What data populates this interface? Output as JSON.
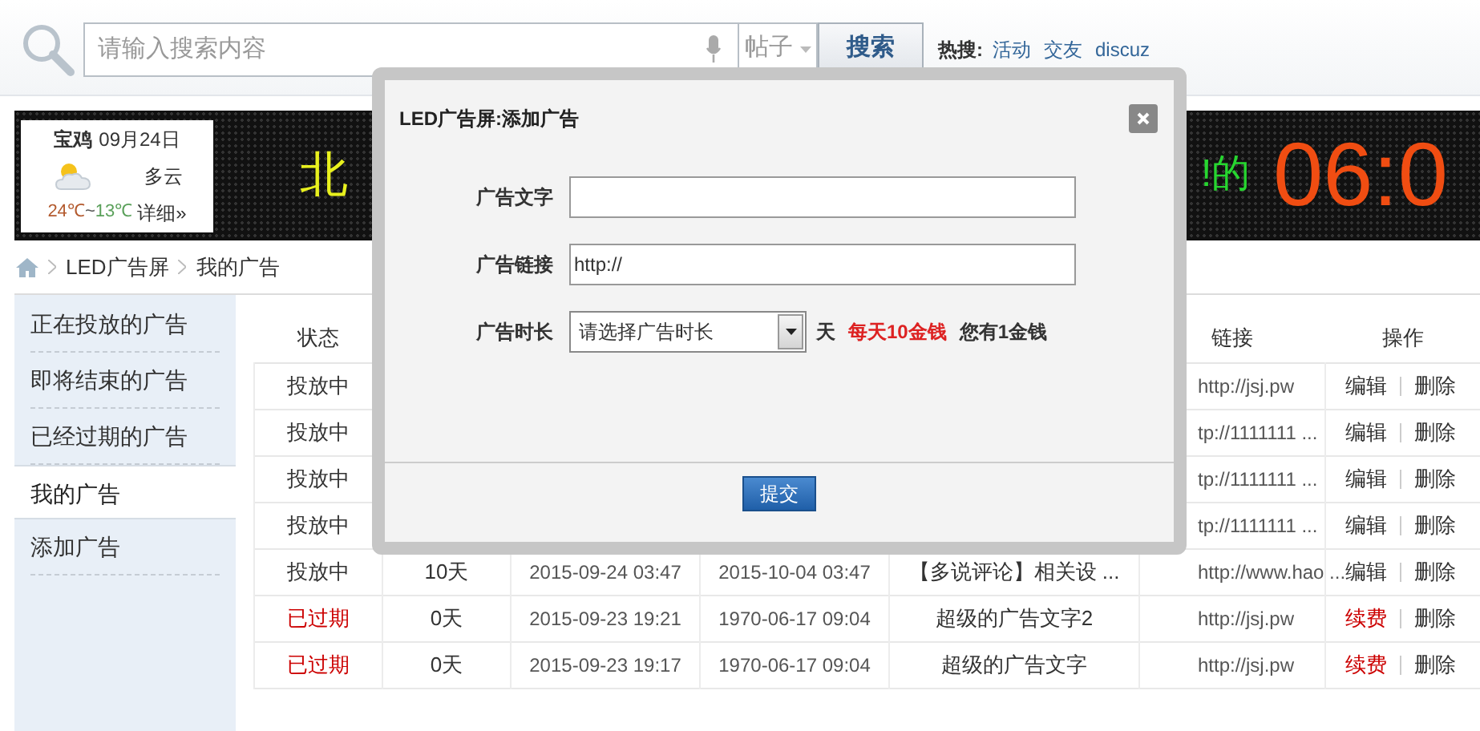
{
  "search": {
    "placeholder": "请输入搜索内容",
    "scope": "帖子",
    "button": "搜索",
    "hot_label": "热搜:",
    "hot_links": [
      "活动",
      "交友",
      "discuz"
    ]
  },
  "led_banner": {
    "weather": {
      "city": "宝鸡",
      "date": "09月24日",
      "condition": "多云",
      "high": "24℃",
      "separator": "~",
      "low": "13℃",
      "details": "详细»"
    },
    "text_left": "北",
    "text_right": "!的",
    "clock": "06:0"
  },
  "breadcrumb": [
    "LED广告屏",
    "我的广告"
  ],
  "sidebar": {
    "items": [
      {
        "label": "正在投放的广告",
        "selected": false
      },
      {
        "label": "即将结束的广告",
        "selected": false
      },
      {
        "label": "已经过期的广告",
        "selected": false
      },
      {
        "label": "我的广告",
        "selected": true
      },
      {
        "label": "添加广告",
        "selected": false
      }
    ]
  },
  "table": {
    "columns": [
      "状态",
      null,
      null,
      null,
      null,
      "链接",
      "操作"
    ],
    "rows": [
      {
        "status": "投放中",
        "expired": false,
        "link": "http://jsj.pw",
        "actions": [
          {
            "label": "编辑",
            "kind": "edit"
          },
          {
            "label": "删除",
            "kind": "delete"
          }
        ]
      },
      {
        "status": "投放中",
        "expired": false,
        "link": "tp://1111111 ...",
        "actions": [
          {
            "label": "编辑",
            "kind": "edit"
          },
          {
            "label": "删除",
            "kind": "delete"
          }
        ]
      },
      {
        "status": "投放中",
        "expired": false,
        "link": "tp://1111111 ...",
        "actions": [
          {
            "label": "编辑",
            "kind": "edit"
          },
          {
            "label": "删除",
            "kind": "delete"
          }
        ]
      },
      {
        "status": "投放中",
        "expired": false,
        "link": "tp://1111111 ...",
        "actions": [
          {
            "label": "编辑",
            "kind": "edit"
          },
          {
            "label": "删除",
            "kind": "delete"
          }
        ]
      },
      {
        "status": "投放中",
        "expired": false,
        "days": "10天",
        "start": "2015-09-24 03:47",
        "end": "2015-10-04 03:47",
        "text": "【多说评论】相关设 ...",
        "link": "http://www.hao ...",
        "actions": [
          {
            "label": "编辑",
            "kind": "edit"
          },
          {
            "label": "删除",
            "kind": "delete"
          }
        ]
      },
      {
        "status": "已过期",
        "expired": true,
        "days": "0天",
        "start": "2015-09-23 19:21",
        "end": "1970-06-17 09:04",
        "text": "超级的广告文字2",
        "link": "http://jsj.pw",
        "actions": [
          {
            "label": "续费",
            "kind": "renew"
          },
          {
            "label": "删除",
            "kind": "delete"
          }
        ]
      },
      {
        "status": "已过期",
        "expired": true,
        "days": "0天",
        "start": "2015-09-23 19:17",
        "end": "1970-06-17 09:04",
        "text": "超级的广告文字",
        "link": "http://jsj.pw",
        "actions": [
          {
            "label": "续费",
            "kind": "renew"
          },
          {
            "label": "删除",
            "kind": "delete"
          }
        ]
      }
    ]
  },
  "dialog": {
    "title": "LED广告屏:添加广告",
    "fields": [
      {
        "kind": "text",
        "label": "广告文字"
      },
      {
        "kind": "text",
        "label": "广告链接",
        "value": "http://"
      },
      {
        "kind": "select",
        "label": "广告时长",
        "value": "请选择广告时长",
        "unit": "天",
        "price": "每天10金钱",
        "balance": "您有1金钱"
      }
    ],
    "submit": "提交"
  }
}
